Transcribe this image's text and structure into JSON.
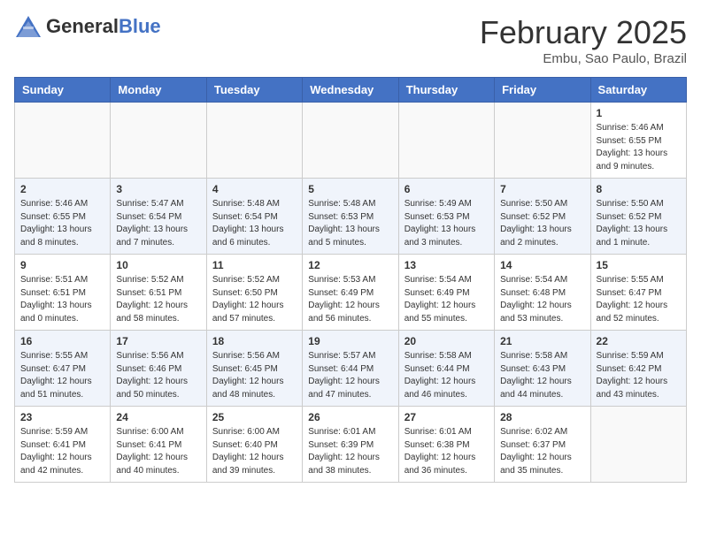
{
  "header": {
    "logo_general": "General",
    "logo_blue": "Blue",
    "month_title": "February 2025",
    "location": "Embu, Sao Paulo, Brazil"
  },
  "days_of_week": [
    "Sunday",
    "Monday",
    "Tuesday",
    "Wednesday",
    "Thursday",
    "Friday",
    "Saturday"
  ],
  "weeks": [
    [
      {
        "day": "",
        "info": ""
      },
      {
        "day": "",
        "info": ""
      },
      {
        "day": "",
        "info": ""
      },
      {
        "day": "",
        "info": ""
      },
      {
        "day": "",
        "info": ""
      },
      {
        "day": "",
        "info": ""
      },
      {
        "day": "1",
        "info": "Sunrise: 5:46 AM\nSunset: 6:55 PM\nDaylight: 13 hours and 9 minutes."
      }
    ],
    [
      {
        "day": "2",
        "info": "Sunrise: 5:46 AM\nSunset: 6:55 PM\nDaylight: 13 hours and 8 minutes."
      },
      {
        "day": "3",
        "info": "Sunrise: 5:47 AM\nSunset: 6:54 PM\nDaylight: 13 hours and 7 minutes."
      },
      {
        "day": "4",
        "info": "Sunrise: 5:48 AM\nSunset: 6:54 PM\nDaylight: 13 hours and 6 minutes."
      },
      {
        "day": "5",
        "info": "Sunrise: 5:48 AM\nSunset: 6:53 PM\nDaylight: 13 hours and 5 minutes."
      },
      {
        "day": "6",
        "info": "Sunrise: 5:49 AM\nSunset: 6:53 PM\nDaylight: 13 hours and 3 minutes."
      },
      {
        "day": "7",
        "info": "Sunrise: 5:50 AM\nSunset: 6:52 PM\nDaylight: 13 hours and 2 minutes."
      },
      {
        "day": "8",
        "info": "Sunrise: 5:50 AM\nSunset: 6:52 PM\nDaylight: 13 hours and 1 minute."
      }
    ],
    [
      {
        "day": "9",
        "info": "Sunrise: 5:51 AM\nSunset: 6:51 PM\nDaylight: 13 hours and 0 minutes."
      },
      {
        "day": "10",
        "info": "Sunrise: 5:52 AM\nSunset: 6:51 PM\nDaylight: 12 hours and 58 minutes."
      },
      {
        "day": "11",
        "info": "Sunrise: 5:52 AM\nSunset: 6:50 PM\nDaylight: 12 hours and 57 minutes."
      },
      {
        "day": "12",
        "info": "Sunrise: 5:53 AM\nSunset: 6:49 PM\nDaylight: 12 hours and 56 minutes."
      },
      {
        "day": "13",
        "info": "Sunrise: 5:54 AM\nSunset: 6:49 PM\nDaylight: 12 hours and 55 minutes."
      },
      {
        "day": "14",
        "info": "Sunrise: 5:54 AM\nSunset: 6:48 PM\nDaylight: 12 hours and 53 minutes."
      },
      {
        "day": "15",
        "info": "Sunrise: 5:55 AM\nSunset: 6:47 PM\nDaylight: 12 hours and 52 minutes."
      }
    ],
    [
      {
        "day": "16",
        "info": "Sunrise: 5:55 AM\nSunset: 6:47 PM\nDaylight: 12 hours and 51 minutes."
      },
      {
        "day": "17",
        "info": "Sunrise: 5:56 AM\nSunset: 6:46 PM\nDaylight: 12 hours and 50 minutes."
      },
      {
        "day": "18",
        "info": "Sunrise: 5:56 AM\nSunset: 6:45 PM\nDaylight: 12 hours and 48 minutes."
      },
      {
        "day": "19",
        "info": "Sunrise: 5:57 AM\nSunset: 6:44 PM\nDaylight: 12 hours and 47 minutes."
      },
      {
        "day": "20",
        "info": "Sunrise: 5:58 AM\nSunset: 6:44 PM\nDaylight: 12 hours and 46 minutes."
      },
      {
        "day": "21",
        "info": "Sunrise: 5:58 AM\nSunset: 6:43 PM\nDaylight: 12 hours and 44 minutes."
      },
      {
        "day": "22",
        "info": "Sunrise: 5:59 AM\nSunset: 6:42 PM\nDaylight: 12 hours and 43 minutes."
      }
    ],
    [
      {
        "day": "23",
        "info": "Sunrise: 5:59 AM\nSunset: 6:41 PM\nDaylight: 12 hours and 42 minutes."
      },
      {
        "day": "24",
        "info": "Sunrise: 6:00 AM\nSunset: 6:41 PM\nDaylight: 12 hours and 40 minutes."
      },
      {
        "day": "25",
        "info": "Sunrise: 6:00 AM\nSunset: 6:40 PM\nDaylight: 12 hours and 39 minutes."
      },
      {
        "day": "26",
        "info": "Sunrise: 6:01 AM\nSunset: 6:39 PM\nDaylight: 12 hours and 38 minutes."
      },
      {
        "day": "27",
        "info": "Sunrise: 6:01 AM\nSunset: 6:38 PM\nDaylight: 12 hours and 36 minutes."
      },
      {
        "day": "28",
        "info": "Sunrise: 6:02 AM\nSunset: 6:37 PM\nDaylight: 12 hours and 35 minutes."
      },
      {
        "day": "",
        "info": ""
      }
    ]
  ]
}
